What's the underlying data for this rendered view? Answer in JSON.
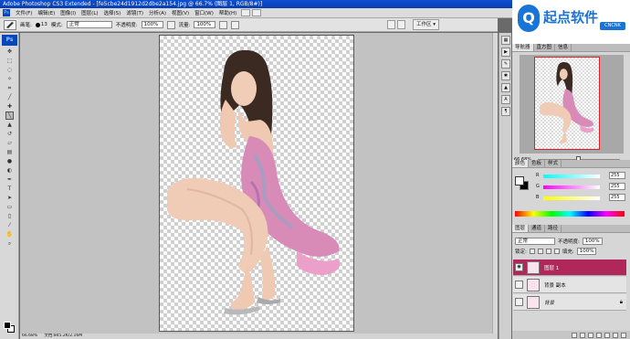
{
  "app": {
    "title": "Adobe Photoshop CS3 Extended - [fe5cbe24d1912d2dbe2a154.jpg @ 66.7% (图层 1, RGB/8#)]",
    "ps_label": "Ps"
  },
  "menu": [
    "文件(F)",
    "编辑(E)",
    "图像(I)",
    "图层(L)",
    "选择(S)",
    "滤镜(T)",
    "分析(A)",
    "视图(V)",
    "窗口(W)",
    "帮助(H)"
  ],
  "options": {
    "brush_label": "画笔:",
    "brush_size": "13",
    "mode_label": "模式:",
    "mode_value": "正常",
    "opacity_label": "不透明度:",
    "opacity_value": "100%",
    "flow_label": "流量:",
    "flow_value": "100%",
    "workspace_label": "工作区 ▾"
  },
  "watermark": {
    "text": "起点软件",
    "tag": "CNCNK"
  },
  "status": {
    "zoom": "66.68%",
    "doc": "文档:845.2K/2.16M"
  },
  "navigator": {
    "tabs": [
      "导航器",
      "直方图",
      "信息"
    ],
    "zoom": "66.68%"
  },
  "color": {
    "tabs": [
      "颜色",
      "色板",
      "样式"
    ],
    "r_label": "R",
    "g_label": "G",
    "b_label": "B",
    "r_value": "255",
    "g_value": "255",
    "b_value": "255"
  },
  "layers": {
    "tabs": [
      "图层",
      "通道",
      "路径"
    ],
    "blend_mode": "正常",
    "opacity_label": "不透明度:",
    "opacity_value": "100%",
    "lock_label": "锁定:",
    "fill_label": "填充:",
    "fill_value": "100%",
    "items": [
      {
        "name": "图层 1",
        "visible": true,
        "active": true
      },
      {
        "name": "背景 副本",
        "visible": false,
        "active": false
      },
      {
        "name": "背景",
        "visible": false,
        "active": false
      }
    ]
  }
}
